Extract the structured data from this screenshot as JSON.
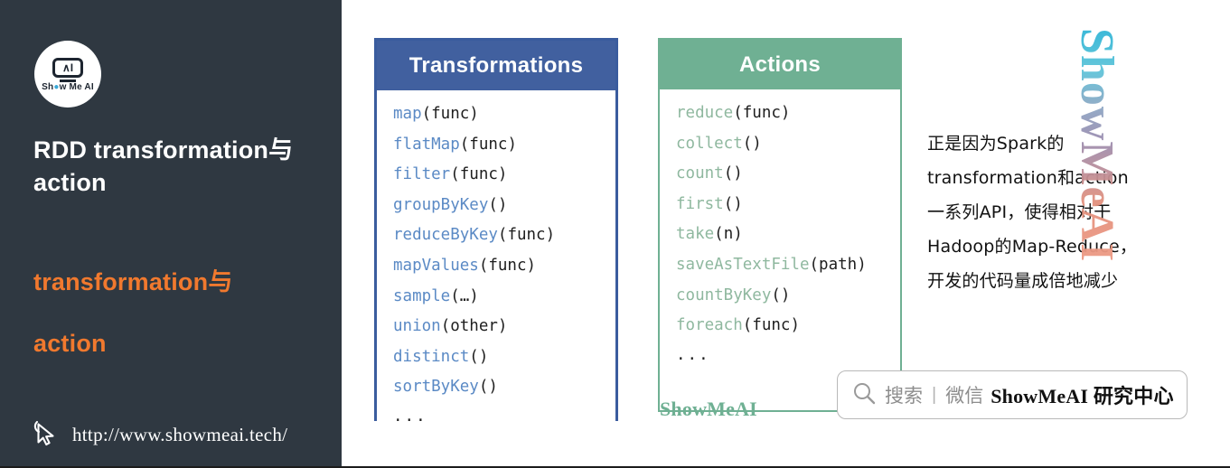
{
  "colors": {
    "sidebar_bg": "#2f3841",
    "accent_orange": "#f1792e",
    "transformations_header": "#41609f",
    "transformations_border": "#3a5c9e",
    "transformations_fn": "#5b8ac5",
    "actions_header": "#6fb093",
    "actions_border": "#6fb093",
    "actions_fn": "#8fb89f",
    "body_text": "#1e1e1e",
    "watermark_start": "#2fb5d6",
    "watermark_end": "#ee9a84"
  },
  "sidebar": {
    "logo": {
      "icon_name": "show-me-ai-logo",
      "robot_face": "∧I",
      "brand_prefix": "Sh",
      "brand_dot": "●",
      "brand_suffix": "w Me AI"
    },
    "title": "RDD transformation与action",
    "keywords": [
      "transformation与",
      "action"
    ],
    "url": "http://www.showmeai.tech/",
    "cursor_icon": "mouse-pointer-icon"
  },
  "cards": [
    {
      "id": "transformations",
      "title": "Transformations",
      "items": [
        {
          "fn": "map",
          "arg": "(func)"
        },
        {
          "fn": "flatMap",
          "arg": "(func)"
        },
        {
          "fn": "filter",
          "arg": "(func)"
        },
        {
          "fn": "groupByKey",
          "arg": "()"
        },
        {
          "fn": "reduceByKey",
          "arg": "(func)"
        },
        {
          "fn": "mapValues",
          "arg": "(func)"
        },
        {
          "fn": "sample",
          "arg": "(…)"
        },
        {
          "fn": "union",
          "arg": "(other)"
        },
        {
          "fn": "distinct",
          "arg": "()"
        },
        {
          "fn": "sortByKey",
          "arg": "()"
        }
      ],
      "more": "..."
    },
    {
      "id": "actions",
      "title": "Actions",
      "items": [
        {
          "fn": "reduce",
          "arg": "(func)"
        },
        {
          "fn": "collect",
          "arg": "()"
        },
        {
          "fn": "count",
          "arg": "()"
        },
        {
          "fn": "first",
          "arg": "()"
        },
        {
          "fn": "take",
          "arg": "(n)"
        },
        {
          "fn": "saveAsTextFile",
          "arg": "(path)"
        },
        {
          "fn": "countByKey",
          "arg": "()"
        },
        {
          "fn": "foreach",
          "arg": "(func)"
        }
      ],
      "more": "..."
    }
  ],
  "green_mark": "ShowMeAI",
  "note": {
    "lines": [
      "正是因为Spark的",
      "transformation和action",
      "一系列API，使得相对干",
      "Hadoop的Map-Reduce，",
      "开发的代码量成倍地减少"
    ]
  },
  "watermark": {
    "text": "ShowMeAI"
  },
  "searchbar": {
    "icon_name": "search-icon",
    "placeholder": "搜索",
    "divider": "|",
    "channel": "微信",
    "brand": "ShowMeAI 研究中心"
  }
}
